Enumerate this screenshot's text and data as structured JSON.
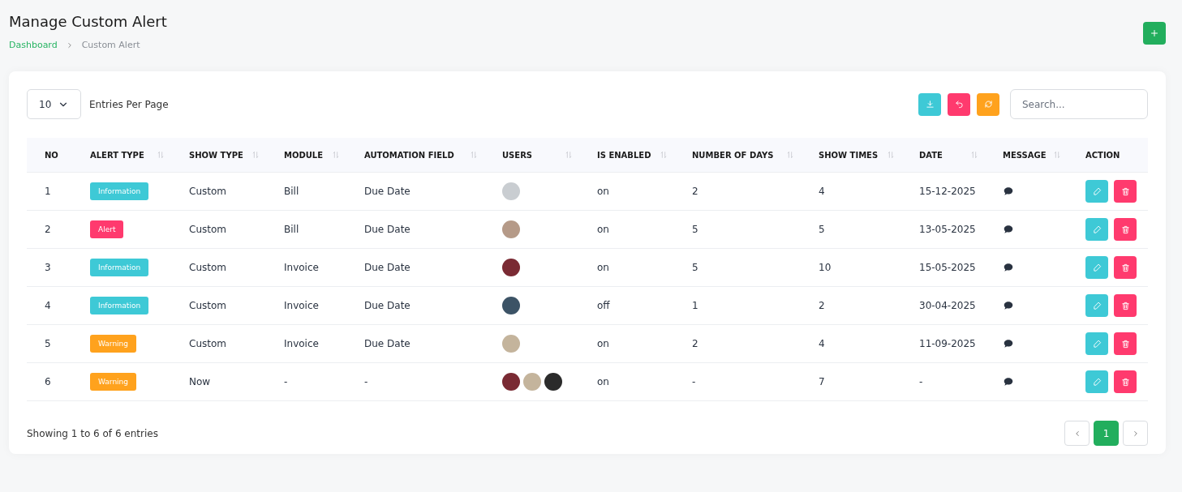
{
  "header": {
    "title": "Manage Custom Alert",
    "breadcrumb": [
      {
        "label": "Dashboard",
        "kind": "link"
      },
      {
        "label": "Custom Alert",
        "kind": "current"
      }
    ]
  },
  "toolbar": {
    "page_size": "10",
    "page_size_label": "Entries Per Page",
    "search": {
      "placeholder": "Search..."
    }
  },
  "table": {
    "columns": [
      {
        "label": "NO",
        "sortable": false
      },
      {
        "label": "ALERT TYPE",
        "sortable": true
      },
      {
        "label": "SHOW TYPE",
        "sortable": true
      },
      {
        "label": "MODULE",
        "sortable": true
      },
      {
        "label": "AUTOMATION FIELD",
        "sortable": true
      },
      {
        "label": "USERS",
        "sortable": true
      },
      {
        "label": "IS ENABLED",
        "sortable": true
      },
      {
        "label": "NUMBER OF DAYS",
        "sortable": true
      },
      {
        "label": "SHOW TIMES",
        "sortable": true
      },
      {
        "label": "DATE",
        "sortable": true
      },
      {
        "label": "MESSAGE",
        "sortable": true
      },
      {
        "label": "ACTION",
        "sortable": false
      }
    ],
    "rows": [
      {
        "no": "1",
        "alert_type": {
          "label": "Information",
          "color": "#3ec9d6"
        },
        "show_type": "Custom",
        "module": "Bill",
        "automation_field": "Due Date",
        "users": [
          {
            "color": "#c9cdd1"
          }
        ],
        "is_enabled": "on",
        "number_of_days": "2",
        "show_times": "4",
        "date": "15-12-2025"
      },
      {
        "no": "2",
        "alert_type": {
          "label": "Alert",
          "color": "#ff3a6e"
        },
        "show_type": "Custom",
        "module": "Bill",
        "automation_field": "Due Date",
        "users": [
          {
            "color": "#b59a88"
          }
        ],
        "is_enabled": "on",
        "number_of_days": "5",
        "show_times": "5",
        "date": "13-05-2025"
      },
      {
        "no": "3",
        "alert_type": {
          "label": "Information",
          "color": "#3ec9d6"
        },
        "show_type": "Custom",
        "module": "Invoice",
        "automation_field": "Due Date",
        "users": [
          {
            "color": "#7a2a33"
          }
        ],
        "is_enabled": "on",
        "number_of_days": "5",
        "show_times": "10",
        "date": "15-05-2025"
      },
      {
        "no": "4",
        "alert_type": {
          "label": "Information",
          "color": "#3ec9d6"
        },
        "show_type": "Custom",
        "module": "Invoice",
        "automation_field": "Due Date",
        "users": [
          {
            "color": "#3c5366"
          }
        ],
        "is_enabled": "off",
        "number_of_days": "1",
        "show_times": "2",
        "date": "30-04-2025"
      },
      {
        "no": "5",
        "alert_type": {
          "label": "Warning",
          "color": "#ffa21d"
        },
        "show_type": "Custom",
        "module": "Invoice",
        "automation_field": "Due Date",
        "users": [
          {
            "color": "#c4b49c"
          }
        ],
        "is_enabled": "on",
        "number_of_days": "2",
        "show_times": "4",
        "date": "11-09-2025"
      },
      {
        "no": "6",
        "alert_type": {
          "label": "Warning",
          "color": "#ffa21d"
        },
        "show_type": "Now",
        "module": "-",
        "automation_field": "-",
        "users": [
          {
            "color": "#7a2a33"
          },
          {
            "color": "#c4b49c"
          },
          {
            "color": "#2b2b2b"
          }
        ],
        "is_enabled": "on",
        "number_of_days": "-",
        "show_times": "7",
        "date": "-"
      }
    ]
  },
  "footer": {
    "summary": "Showing 1 to 6 of 6 entries",
    "pages": [
      {
        "label": "1",
        "selected": true
      }
    ]
  }
}
